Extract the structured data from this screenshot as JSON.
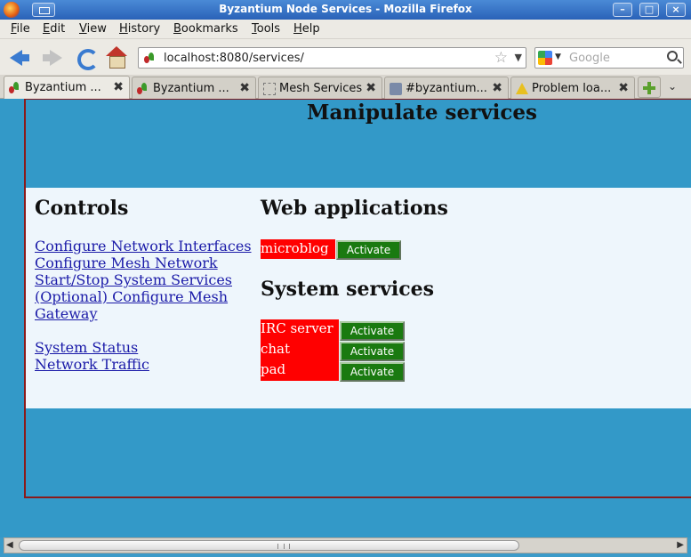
{
  "window": {
    "title": "Byzantium Node Services - Mozilla Firefox"
  },
  "menubar": {
    "items": [
      "File",
      "Edit",
      "View",
      "History",
      "Bookmarks",
      "Tools",
      "Help"
    ]
  },
  "navbar": {
    "url": "localhost:8080/services/",
    "search_placeholder": "Google"
  },
  "tabs": [
    {
      "label": "Byzantium ...",
      "icon": "byzantium-favicon",
      "active": true
    },
    {
      "label": "Byzantium ...",
      "icon": "byzantium-favicon",
      "active": false
    },
    {
      "label": "Mesh Services",
      "icon": "blank-page-icon",
      "active": false
    },
    {
      "label": "#byzantium...",
      "icon": "irc-icon",
      "active": false
    },
    {
      "label": "Problem loa...",
      "icon": "warning-icon",
      "active": false
    }
  ],
  "page": {
    "heading": "Manipulate services",
    "controls": {
      "title": "Controls",
      "links": [
        "Configure Network Interfaces",
        "Configure Mesh Network",
        "Start/Stop System Services",
        "(Optional) Configure Mesh Gateway",
        "System Status",
        "Network Traffic"
      ]
    },
    "web_applications": {
      "title": "Web applications",
      "items": [
        {
          "name": "microblog",
          "action": "Activate"
        }
      ]
    },
    "system_services": {
      "title": "System services",
      "items": [
        {
          "name": "IRC server",
          "action": "Activate"
        },
        {
          "name": "chat",
          "action": "Activate"
        },
        {
          "name": "pad",
          "action": "Activate"
        }
      ]
    }
  },
  "colors": {
    "page_background": "#3399c8",
    "content_background": "#eef6fc",
    "service_label_bg": "#ff0000",
    "activate_button_bg": "#1a7a10",
    "link": "#1a1aa8"
  }
}
